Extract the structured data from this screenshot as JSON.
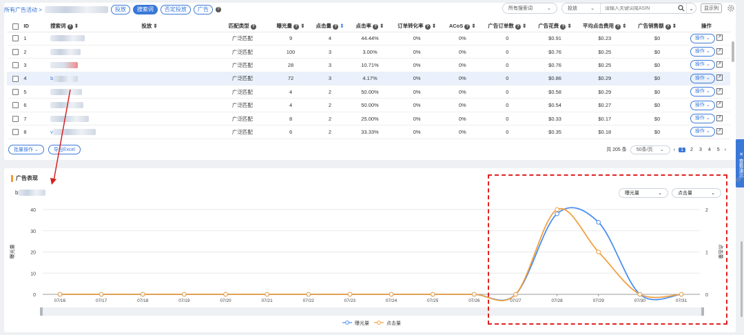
{
  "header": {
    "crumb": "所有广告活动 >",
    "tabs": [
      "投放",
      "搜索词",
      "否定投放",
      "广告"
    ],
    "active_tab": 1,
    "search_scope": "所有搜索词",
    "search_type": "投放",
    "search_placeholder": "请输入关键词或ASIN",
    "columns_btn": "显示列"
  },
  "table": {
    "columns": [
      "ID",
      "搜索词",
      "投放",
      "匹配类型",
      "曝光量",
      "点击量",
      "点击率",
      "订单转化率",
      "ACoS",
      "广告订单数",
      "广告花费",
      "平均点击费用",
      "广告销售额",
      "操作"
    ],
    "rows": [
      {
        "id": "1",
        "kw": "",
        "match": "广泛匹配",
        "imp": "9",
        "clk": "4",
        "ctr": "44.44%",
        "cvr": "0%",
        "acos": "0%",
        "orders": "0",
        "spend": "$0.91",
        "cpc": "$0.23",
        "sales": "$0"
      },
      {
        "id": "2",
        "kw": "",
        "match": "广泛匹配",
        "imp": "100",
        "clk": "3",
        "ctr": "3.00%",
        "cvr": "0%",
        "acos": "0%",
        "orders": "0",
        "spend": "$0.76",
        "cpc": "$0.25",
        "sales": "$0"
      },
      {
        "id": "3",
        "kw": "",
        "match": "广泛匹配",
        "imp": "28",
        "clk": "3",
        "ctr": "10.71%",
        "cvr": "0%",
        "acos": "0%",
        "orders": "0",
        "spend": "$0.76",
        "cpc": "$0.25",
        "sales": "$0"
      },
      {
        "id": "4",
        "kw": "b",
        "match": "广泛匹配",
        "imp": "72",
        "clk": "3",
        "ctr": "4.17%",
        "cvr": "0%",
        "acos": "0%",
        "orders": "0",
        "spend": "$0.86",
        "cpc": "$0.29",
        "sales": "$0"
      },
      {
        "id": "5",
        "kw": "",
        "match": "广泛匹配",
        "imp": "4",
        "clk": "2",
        "ctr": "50.00%",
        "cvr": "0%",
        "acos": "0%",
        "orders": "0",
        "spend": "$0.58",
        "cpc": "$0.29",
        "sales": "$0"
      },
      {
        "id": "6",
        "kw": "",
        "match": "广泛匹配",
        "imp": "4",
        "clk": "2",
        "ctr": "50.00%",
        "cvr": "0%",
        "acos": "0%",
        "orders": "0",
        "spend": "$0.54",
        "cpc": "$0.27",
        "sales": "$0"
      },
      {
        "id": "7",
        "kw": "",
        "match": "广泛匹配",
        "imp": "8",
        "clk": "2",
        "ctr": "25.00%",
        "cvr": "0%",
        "acos": "0%",
        "orders": "0",
        "spend": "$0.33",
        "cpc": "$0.17",
        "sales": "$0"
      },
      {
        "id": "8",
        "kw": "v",
        "match": "广泛匹配",
        "imp": "6",
        "clk": "2",
        "ctr": "33.33%",
        "cvr": "0%",
        "acos": "0%",
        "orders": "0",
        "spend": "$0.35",
        "cpc": "$0.18",
        "sales": "$0"
      }
    ],
    "op_label": "操作"
  },
  "footer": {
    "bulk": "批量操作",
    "export": "导出Excel",
    "total": "共 205 条",
    "page_size": "50条/页",
    "pages": [
      "1",
      "2",
      "3",
      "4",
      "5"
    ]
  },
  "side_tab": "查看演示",
  "perf": {
    "title": "广告表现",
    "keyword": "b",
    "metric_left": "曝光量",
    "metric_right": "点击量",
    "left_axis_label": "曝光量",
    "right_axis_label": "点击量"
  },
  "chart_data": {
    "type": "line",
    "x": [
      "07/16",
      "07/17",
      "07/18",
      "07/19",
      "07/20",
      "07/21",
      "07/22",
      "07/23",
      "07/24",
      "07/25",
      "07/26",
      "07/27",
      "07/28",
      "07/29",
      "07/30",
      "07/31"
    ],
    "series": [
      {
        "name": "曝光量",
        "axis": "left",
        "color": "#4a8ef0",
        "values": [
          0,
          0,
          0,
          0,
          0,
          0,
          0,
          0,
          0,
          0,
          0,
          0,
          38,
          34,
          0,
          0
        ]
      },
      {
        "name": "点击量",
        "axis": "right",
        "color": "#f0a040",
        "values": [
          0,
          0,
          0,
          0,
          0,
          0,
          0,
          0,
          0,
          0,
          0,
          0,
          2,
          1,
          0,
          0
        ]
      }
    ],
    "ylim_left": [
      0,
      40
    ],
    "ylim_right": [
      0,
      2
    ],
    "yticks_left": [
      "0",
      "10",
      "20",
      "30",
      "40"
    ],
    "yticks_right": [
      "0",
      "1",
      "2"
    ],
    "legend": "bottom"
  }
}
